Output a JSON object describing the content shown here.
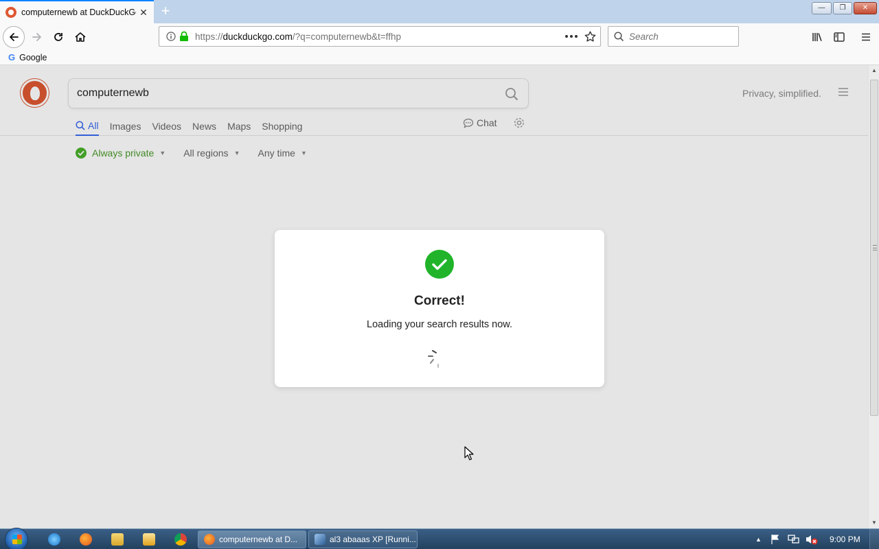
{
  "browser": {
    "tab": {
      "title": "computernewb at DuckDuckGo",
      "close": "✕"
    },
    "new_tab": "+",
    "window_controls": {
      "minimize": "—",
      "maximize": "❐",
      "close": "✕"
    },
    "url": {
      "prefix": "https://",
      "host": "duckduckgo.com",
      "path": "/?q=computernewb&t=ffhp"
    },
    "search_placeholder": "Search",
    "bookmarks": [
      {
        "icon": "G",
        "label": "Google"
      }
    ]
  },
  "page": {
    "search": {
      "value": "computernewb"
    },
    "tagline": "Privacy, simplified.",
    "tabs": [
      "All",
      "Images",
      "Videos",
      "News",
      "Maps",
      "Shopping"
    ],
    "chat_label": "Chat",
    "filters": {
      "safe": "Always private",
      "region": "All regions",
      "time": "Any time"
    },
    "modal": {
      "title": "Correct!",
      "subtitle": "Loading your search results now."
    }
  },
  "taskbar": {
    "tasks": [
      "computernewb at D...",
      "al3 abaaas XP [Runni..."
    ],
    "clock": "9:00 PM"
  },
  "colors": {
    "ddg_accent": "#de5833",
    "link_blue": "#3969ef",
    "success_green": "#21b42b",
    "private_green": "#4ab22c"
  }
}
